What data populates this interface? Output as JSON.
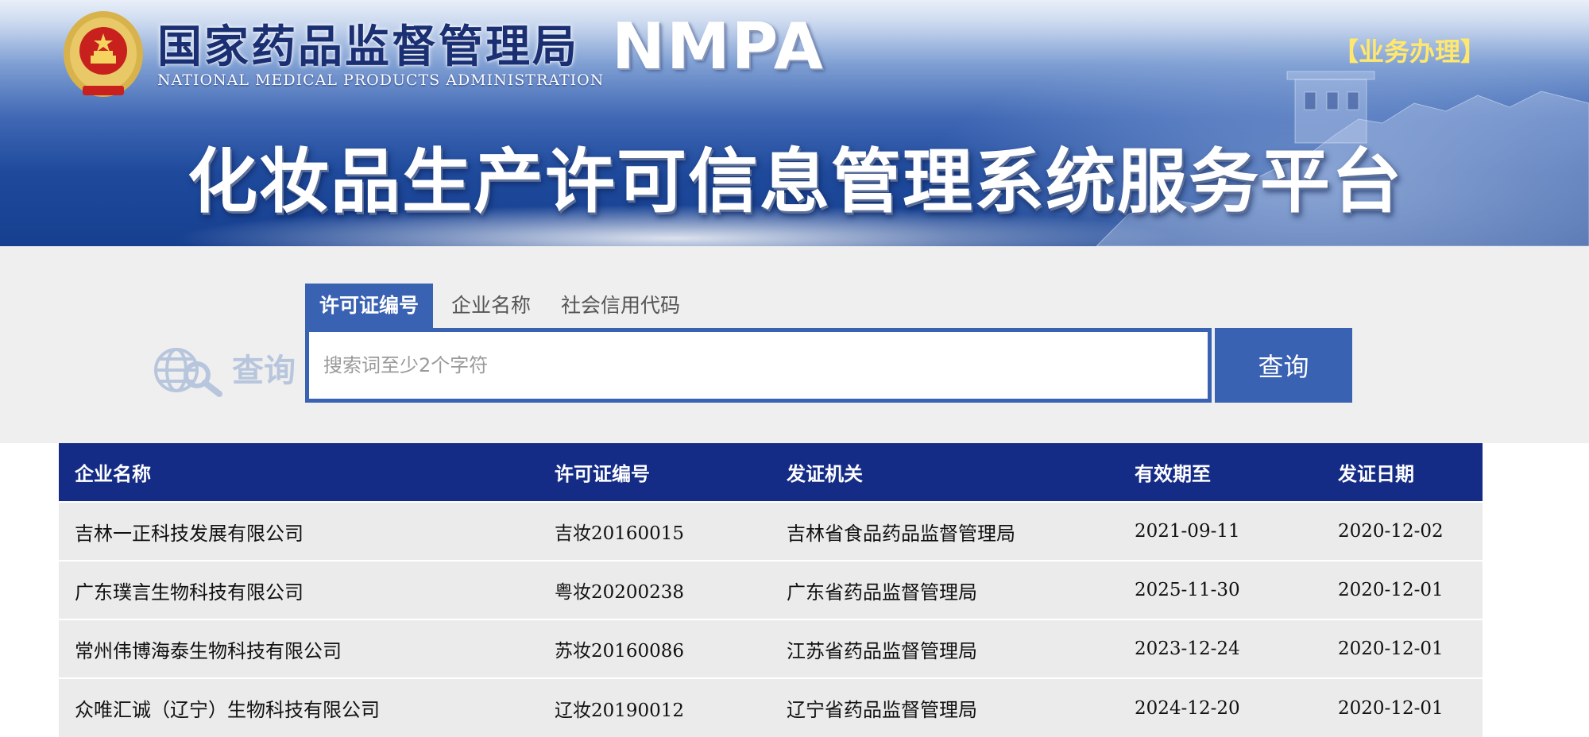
{
  "header": {
    "org_name_cn": "国家药品监督管理局",
    "org_name_en": "NATIONAL MEDICAL PRODUCTS ADMINISTRATION",
    "org_abbr": "NMPA",
    "business_link": "【业务办理】",
    "platform_title": "化妆品生产许可信息管理系统服务平台"
  },
  "search": {
    "logo_text": "查询",
    "tabs": [
      {
        "label": "许可证编号",
        "active": true
      },
      {
        "label": "企业名称",
        "active": false
      },
      {
        "label": "社会信用代码",
        "active": false
      }
    ],
    "placeholder": "搜索词至少2个字符",
    "value": "",
    "button_label": "查询"
  },
  "table": {
    "columns": [
      "企业名称",
      "许可证编号",
      "发证机关",
      "有效期至",
      "发证日期"
    ],
    "rows": [
      [
        "吉林一正科技发展有限公司",
        "吉妆20160015",
        "吉林省食品药品监督管理局",
        "2021-09-11",
        "2020-12-02"
      ],
      [
        "广东璞言生物科技有限公司",
        "粤妆20200238",
        "广东省药品监督管理局",
        "2025-11-30",
        "2020-12-01"
      ],
      [
        "常州伟博海泰生物科技有限公司",
        "苏妆20160086",
        "江苏省药品监督管理局",
        "2023-12-24",
        "2020-12-01"
      ],
      [
        "众唯汇诚（辽宁）生物科技有限公司",
        "辽妆20190012",
        "辽宁省药品监督管理局",
        "2024-12-20",
        "2020-12-01"
      ]
    ]
  },
  "colors": {
    "banner_blue": "#1f4a9c",
    "accent_blue": "#3a62b3",
    "table_header": "#152c87",
    "link_yellow": "#ffe86b",
    "panel_gray": "#efefef",
    "row_gray": "#ebebeb"
  },
  "icons": [
    "national-emblem-icon",
    "globe-search-icon"
  ]
}
